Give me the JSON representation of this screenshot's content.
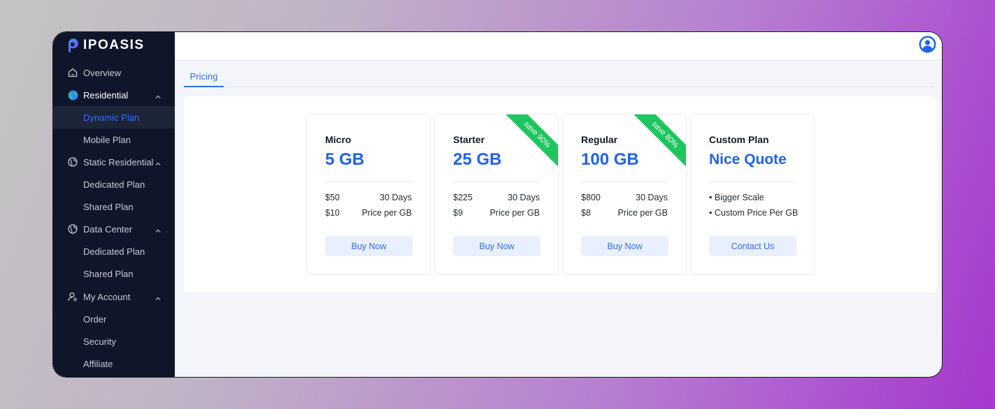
{
  "brand": {
    "name": "IPOASIS"
  },
  "sidebar": {
    "items": [
      {
        "label": "Overview",
        "icon": "home-icon"
      },
      {
        "label": "Residential",
        "icon": "globe-color-icon"
      },
      {
        "label": "Dynamic Plan"
      },
      {
        "label": "Mobile Plan"
      },
      {
        "label": "Static Residential",
        "icon": "globe-icon"
      },
      {
        "label": "Dedicated Plan"
      },
      {
        "label": "Shared Plan"
      },
      {
        "label": "Data Center",
        "icon": "globe-icon"
      },
      {
        "label": "Dedicated Plan"
      },
      {
        "label": "Shared Plan"
      },
      {
        "label": "My Account",
        "icon": "user-icon"
      },
      {
        "label": "Order"
      },
      {
        "label": "Security"
      },
      {
        "label": "Affiliate"
      }
    ]
  },
  "tabs": [
    {
      "label": "Pricing"
    }
  ],
  "plans": [
    {
      "name": "Micro",
      "amount": "5 GB",
      "price": "$50",
      "duration": "30 Days",
      "unit_price": "$10",
      "unit_label": "Price per GB",
      "button": "Buy Now"
    },
    {
      "name": "Starter",
      "amount": "25 GB",
      "price": "$225",
      "duration": "30 Days",
      "unit_price": "$9",
      "unit_label": "Price per GB",
      "button": "Buy Now",
      "ribbon": "save 90%"
    },
    {
      "name": "Regular",
      "amount": "100 GB",
      "price": "$800",
      "duration": "30 Days",
      "unit_price": "$8",
      "unit_label": "Price per GB",
      "button": "Buy Now",
      "ribbon": "save 80%"
    },
    {
      "name": "Custom Plan",
      "amount": "Nice Quote",
      "bullets": [
        "Bigger Scale",
        "Custom Price Per GB"
      ],
      "button": "Contact Us"
    }
  ],
  "colors": {
    "accent": "#2f6ef5",
    "sidebar_bg": "#0f1629",
    "ribbon": "#1fc55e"
  }
}
